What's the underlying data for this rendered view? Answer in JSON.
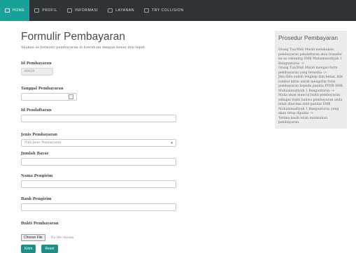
{
  "nav": {
    "items": [
      {
        "label": "HOME",
        "icon": "home-icon",
        "active": true
      },
      {
        "label": "PROFIL",
        "icon": "profile-icon",
        "active": false
      },
      {
        "label": "INFORMASI",
        "icon": "info-icon",
        "active": false
      },
      {
        "label": "LAYANAN",
        "icon": "service-icon",
        "active": false
      },
      {
        "label": "TRY COLLISION",
        "icon": "window-icon",
        "active": false
      }
    ]
  },
  "form": {
    "title": "Formulir Pembayaran",
    "subtitle": "Silakan isi formulir pembayaran di bawah ini dengan benar dan tepat.",
    "id_pembayaran": {
      "label": "Id Pembayaran",
      "value": "00020"
    },
    "tanggal": {
      "label": "Tanggal Pembayaran",
      "value": ""
    },
    "id_pendaftaran": {
      "label": "Id Pendaftaran",
      "value": ""
    },
    "jenis": {
      "label": "Jenis Pembayaran",
      "value": "Pilih Jenis Pembayaran"
    },
    "jumlah": {
      "label": "Jumlah Bayar",
      "value": ""
    },
    "nama_pengirim": {
      "label": "Nama Pengirim",
      "value": ""
    },
    "bank_pengirim": {
      "label": "Bank Pengirim",
      "value": ""
    },
    "bukti": {
      "label": "Bukti Pembayaran",
      "button": "Choose File",
      "status": "No file chosen"
    },
    "buttons": {
      "submit": "Kirim",
      "reset": "Reset"
    }
  },
  "sidebar": {
    "title": "Prosedur Pembayaran",
    "text": "Orang Tua/Wali Murid melakukan pembayaran pendaftaran atau transfer ke no rekening SMK Muhammadiyah 1 Bangunturus ->\nOrang Tua/Wali Murid mengisi form pembayaran yang tersedia ->\nJika data sudah lengkap dan benar, klik tombol kirim untuk mengirim form pembayaran kepada panitia PPDB SMK Muhammadiyah 1 Bangunturus ->\nMaka akan muncul bukti pembayaran sebagai bukti bahwa pembayaran anda telah diterima oleh panitia SMK Muhammadiyah 1 Bangunturus yang akan tetap dipakai ->\nTerima kasih telah melakukan pembayaran."
  },
  "colors": {
    "accent": "#19a29a",
    "nav_bg": "#2e3338",
    "button": "#1e8f87"
  }
}
